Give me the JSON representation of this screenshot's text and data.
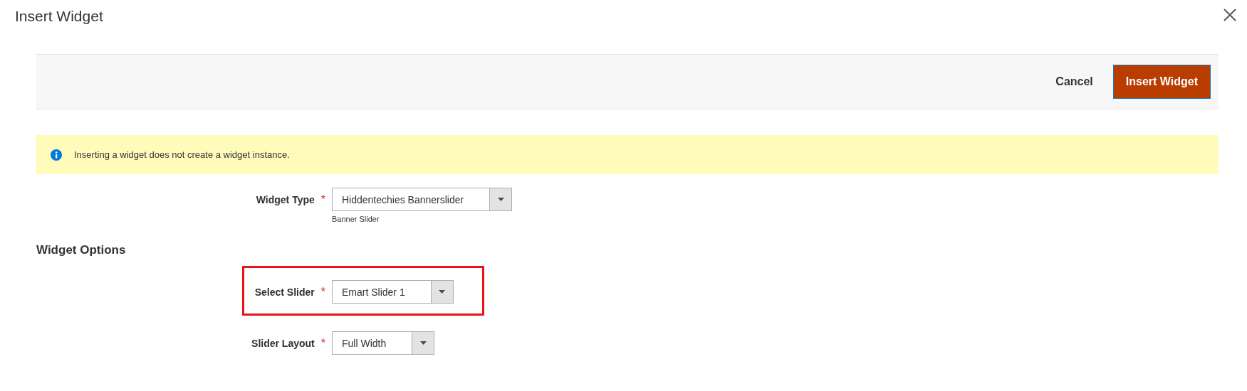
{
  "modal": {
    "title": "Insert Widget"
  },
  "actions": [
    {
      "kind": "link",
      "label": "Cancel"
    },
    {
      "kind": "primary",
      "label": "Insert Widget"
    }
  ],
  "notice": {
    "kind": "info",
    "text": "Inserting a widget does not create a widget instance."
  },
  "fields": [
    {
      "label": "Widget Type",
      "required_mark": "*",
      "value": "Hiddentechies Bannerslider",
      "note": "Banner Slider",
      "highlighted": false
    }
  ],
  "section": {
    "title": "Widget Options"
  },
  "options": [
    {
      "label": "Select Slider",
      "required_mark": "*",
      "value": "Emart Slider 1",
      "highlighted": true
    },
    {
      "label": "Slider Layout",
      "required_mark": "*",
      "value": "Full Width",
      "highlighted": false
    }
  ]
}
